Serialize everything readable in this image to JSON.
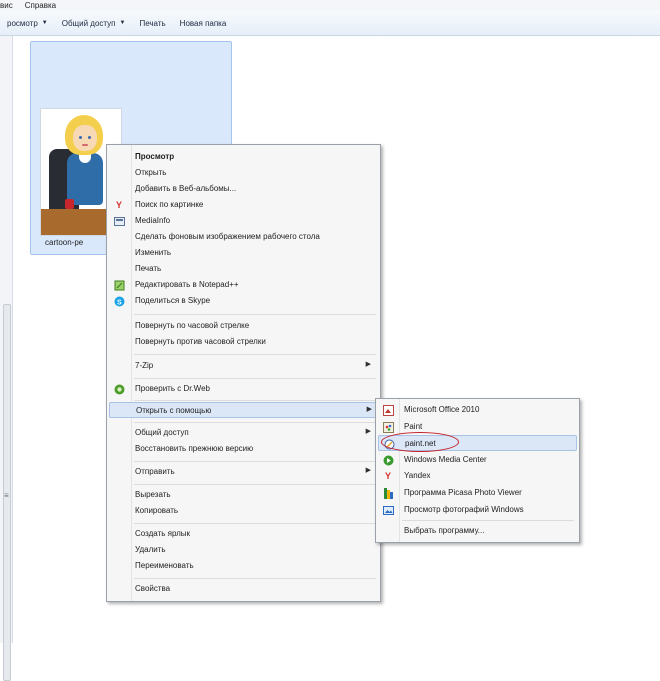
{
  "menubar": {
    "items": [
      "вис",
      "Справка"
    ]
  },
  "toolbar": {
    "buttons": [
      {
        "label": "росмотр",
        "dropdown": true
      },
      {
        "label": "Общий доступ",
        "dropdown": true
      },
      {
        "label": "Печать",
        "dropdown": false
      },
      {
        "label": "Новая папка",
        "dropdown": false
      }
    ]
  },
  "file": {
    "name": "cartoon-pe"
  },
  "context_menu": {
    "items": [
      {
        "label": "Просмотр",
        "bold": true,
        "icon": ""
      },
      {
        "label": "Открыть",
        "icon": ""
      },
      {
        "label": "Добавить в Веб-альбомы...",
        "icon": ""
      },
      {
        "label": "Поиск по картинке",
        "icon": "yandex-icon"
      },
      {
        "label": "MediaInfo",
        "icon": "mediainfo-icon"
      },
      {
        "label": "Сделать фоновым изображением рабочего стола",
        "icon": ""
      },
      {
        "label": "Изменить",
        "icon": ""
      },
      {
        "label": "Печать",
        "icon": ""
      },
      {
        "label": "Редактировать в Notepad++",
        "icon": "notepadpp-icon"
      },
      {
        "label": "Поделиться в Skype",
        "icon": "skype-icon"
      },
      {
        "label": "Повернуть по часовой стрелке",
        "icon": ""
      },
      {
        "label": "Повернуть против часовой стрелки",
        "icon": ""
      },
      {
        "label": "7-Zip",
        "icon": "",
        "submenu": true
      },
      {
        "label": "Проверить с Dr.Web",
        "icon": "drweb-icon"
      },
      {
        "label": "Открыть с помощью",
        "icon": "",
        "submenu": true,
        "highlighted": true
      },
      {
        "label": "Общий доступ",
        "icon": "",
        "submenu": true
      },
      {
        "label": "Восстановить прежнюю версию",
        "icon": ""
      },
      {
        "label": "Отправить",
        "icon": "",
        "submenu": true
      },
      {
        "label": "Вырезать",
        "icon": ""
      },
      {
        "label": "Копировать",
        "icon": ""
      },
      {
        "label": "Создать ярлык",
        "icon": ""
      },
      {
        "label": "Удалить",
        "icon": ""
      },
      {
        "label": "Переименовать",
        "icon": ""
      },
      {
        "label": "Свойства",
        "icon": ""
      }
    ]
  },
  "open_with_submenu": {
    "items": [
      {
        "label": "Microsoft Office 2010",
        "icon": "office-picture-icon"
      },
      {
        "label": "Paint",
        "icon": "paint-icon"
      },
      {
        "label": "paint.net",
        "icon": "paintnet-icon",
        "highlighted": true,
        "circled": true
      },
      {
        "label": "Windows Media Center",
        "icon": "media-center-icon"
      },
      {
        "label": "Yandex",
        "icon": "yandex-icon"
      },
      {
        "label": "Программа Picasa Photo Viewer",
        "icon": "picasa-icon"
      },
      {
        "label": "Просмотр фотографий Windows",
        "icon": "photo-viewer-icon"
      },
      {
        "label": "Выбрать программу...",
        "icon": ""
      }
    ]
  },
  "colors": {
    "selection_bg": "#d9e8fb",
    "menu_highlight": "#dbe7f6",
    "annotation_circle": "#c31f26"
  }
}
